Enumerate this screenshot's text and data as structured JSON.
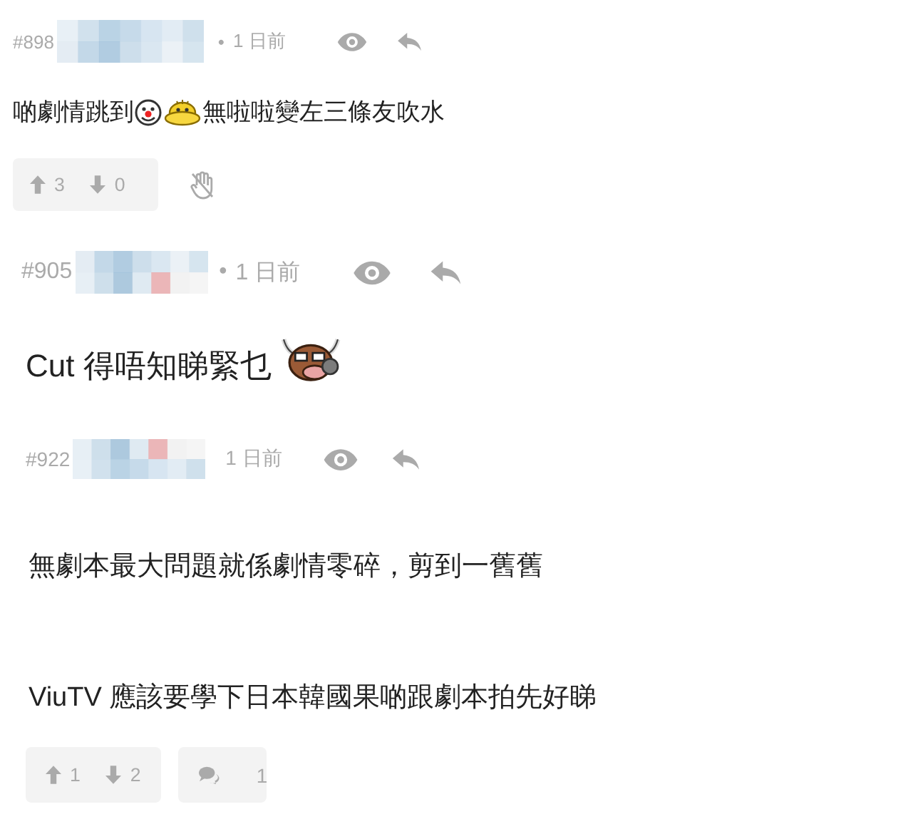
{
  "posts": [
    {
      "number": "#898",
      "dot": "•",
      "time": "1 日前",
      "paragraphs": [
        [
          {
            "kind": "text",
            "text": "啲劇情跳到"
          },
          {
            "kind": "emoji"
          },
          {
            "kind": "emoji"
          },
          {
            "kind": "text",
            "text": "無啦啦變左三條友吹水"
          }
        ]
      ],
      "votes": {
        "up": "3",
        "down": "0"
      },
      "hand": true
    },
    {
      "number": "#905",
      "dot": "•",
      "time": "1 日前",
      "paragraphs": [
        [
          {
            "kind": "text",
            "text": "Cut 得唔知睇緊乜"
          },
          {
            "kind": "emoji"
          }
        ]
      ]
    },
    {
      "number": "#922",
      "time": "1 日前",
      "paragraphs": [
        [
          {
            "kind": "text",
            "text": "無劇本最大問題就係劇情零碎，剪到一舊舊"
          }
        ],
        [
          {
            "kind": "text",
            "text": "ViuTV 應該要學下日本韓國果啲跟劇本拍先好睇"
          }
        ]
      ],
      "votes": {
        "up": "1",
        "down": "2"
      },
      "comments": "1"
    }
  ]
}
